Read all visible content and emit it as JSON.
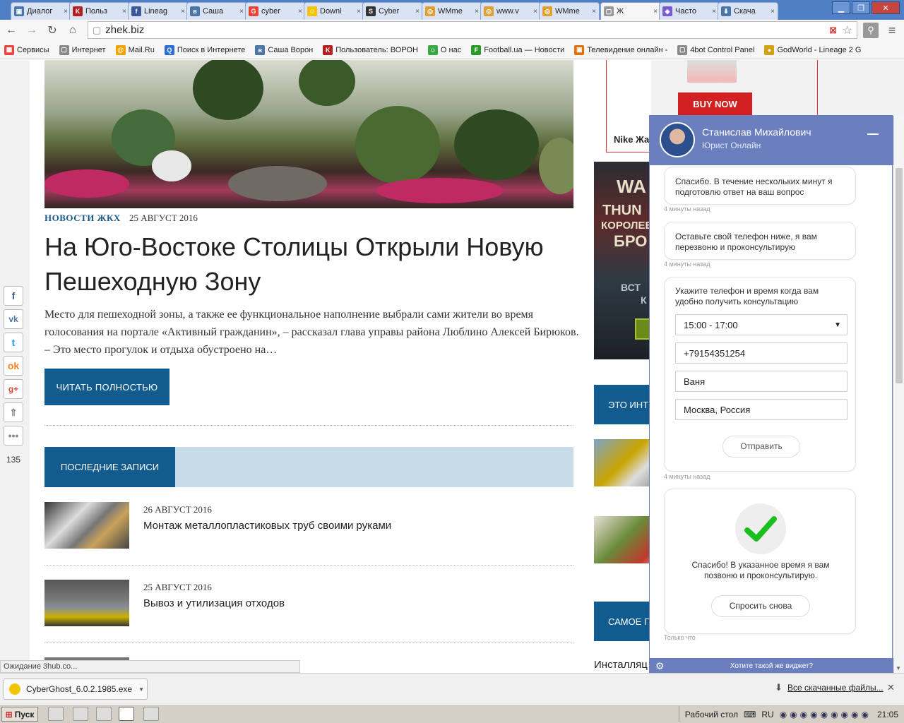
{
  "tabs": [
    {
      "title": "Диалог",
      "color": "#4a76a8",
      "glyph": "▣"
    },
    {
      "title": "Польз",
      "color": "#b41e1e",
      "glyph": "K"
    },
    {
      "title": "Lineag",
      "color": "#3b5998",
      "glyph": "f"
    },
    {
      "title": "Саша",
      "color": "#4a76a8",
      "glyph": "в"
    },
    {
      "title": "cyber",
      "color": "#ea4335",
      "glyph": "G"
    },
    {
      "title": "Downl",
      "color": "#f5c400",
      "glyph": "☺"
    },
    {
      "title": "Cyber",
      "color": "#333333",
      "glyph": "S"
    },
    {
      "title": "WMme",
      "color": "#e0a030",
      "glyph": "◎"
    },
    {
      "title": "www.v",
      "color": "#e0a030",
      "glyph": "◎"
    },
    {
      "title": "WMme",
      "color": "#e0a030",
      "glyph": "◎"
    },
    {
      "title": "Ж",
      "color": "#999999",
      "glyph": "▢"
    },
    {
      "title": "Часто",
      "color": "#7a5bd0",
      "glyph": "◈"
    },
    {
      "title": "Скача",
      "color": "#4a76a8",
      "glyph": "⬇"
    }
  ],
  "address": "zhek.biz",
  "bookmarks": [
    {
      "label": "Сервисы",
      "color": "#e8453c",
      "glyph": "▦"
    },
    {
      "label": "Интернет",
      "color": "#888888",
      "glyph": "▢"
    },
    {
      "label": "Mail.Ru",
      "color": "#f5a100",
      "glyph": "@"
    },
    {
      "label": "Поиск в Интернете",
      "color": "#2d6ed6",
      "glyph": "Q"
    },
    {
      "label": "Саша Ворон",
      "color": "#4a76a8",
      "glyph": "в"
    },
    {
      "label": "Пользователь: ВОРОН",
      "color": "#b41e1e",
      "glyph": "K"
    },
    {
      "label": "О нас",
      "color": "#3aa845",
      "glyph": "☺"
    },
    {
      "label": "Football.ua — Новости",
      "color": "#2a9a2a",
      "glyph": "F"
    },
    {
      "label": "Телевидение онлайн -",
      "color": "#e0700a",
      "glyph": "▣"
    },
    {
      "label": "4bot Control Panel",
      "color": "#888888",
      "glyph": "▢"
    },
    {
      "label": "GodWorld - Lineage 2 G",
      "color": "#d4a017",
      "glyph": "●"
    }
  ],
  "article": {
    "category": "НОВОСТИ ЖКХ",
    "date": "25 АВГУСТ 2016",
    "title": "На Юго-Востоке Столицы Открыли Новую Пешеходную Зону",
    "excerpt": "Место для пешеходной зоны, а также ее функциональное наполнение выбрали сами жители во время голосования на портале «Активный гражданин», – рассказал глава управы района Люблино Алексей Бирюков. – Это место прогулок и отдыха обустроено на…",
    "read_more": "ЧИТАТЬ ПОЛНОСТЬЮ"
  },
  "recent": {
    "heading": "ПОСЛЕДНИЕ ЗАПИСИ",
    "posts": [
      {
        "date": "26 АВГУСТ 2016",
        "title": "Монтаж металлопластиковых труб своими руками"
      },
      {
        "date": "25 АВГУСТ 2016",
        "title": "Вывоз и утилизация отходов"
      }
    ]
  },
  "sidebar": {
    "buy_now": "BUY NOW",
    "ad_caption": "Nike Жа",
    "game_ad_1": "WA",
    "game_ad_2": "THUN",
    "game_ad_3": "КОРОЛЕВ",
    "game_ad_4": "БРО",
    "game_ad_5": "ВСТ",
    "game_ad_6": "К",
    "interesting": "ЭТО ИНТ",
    "popular": "САМОЕ П",
    "install": "Инсталляц"
  },
  "share": {
    "count": "135"
  },
  "chat": {
    "operator_name": "Станислав Михайлович",
    "operator_role": "Юрист Онлайн",
    "msg1": "Спасибо. В течение нескольких минут я подготовлю ответ на ваш вопрос",
    "msg1_time": "4 минуты назад",
    "msg2": "Оставьте свой телефон ниже, я вам перезвоню и проконсультирую",
    "msg2_time": "4 минуты назад",
    "form_prompt": "Укажите телефон и время когда вам удобно получить консультацию",
    "time_value": "15:00 - 17:00",
    "phone_value": "+79154351254",
    "name_value": "Ваня",
    "city_value": "Москва, Россия",
    "send_label": "Отправить",
    "form_time": "4 минуты назад",
    "thanks": "Спасибо! В указанное время я вам позвоню и проконсультирую.",
    "ask_again": "Спросить снова",
    "thanks_time": "Только что",
    "footer": "Хотите такой же виджет?"
  },
  "status": "Ожидание 3hub.co...",
  "download": {
    "file": "CyberGhost_6.0.2.1985.exe",
    "all": "Все скачанные файлы..."
  },
  "taskbar": {
    "start": "Пуск",
    "desktop": "Рабочий стол",
    "lang": "RU",
    "clock": "21:05"
  }
}
